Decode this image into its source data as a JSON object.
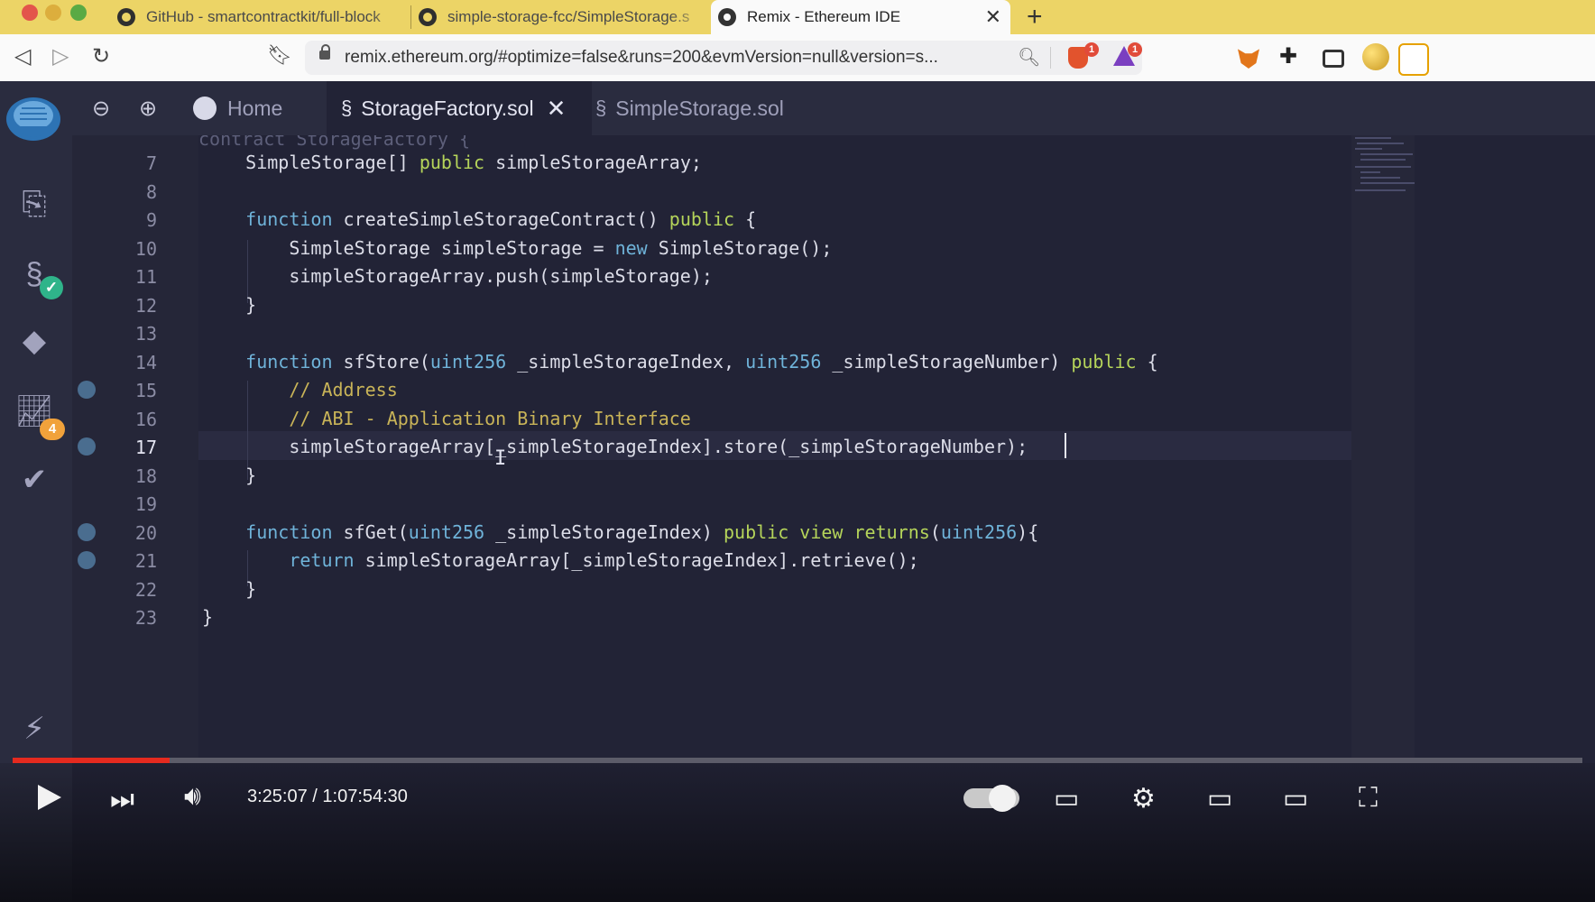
{
  "browser": {
    "tabs": [
      {
        "title": "GitHub - smartcontractkit/full-block",
        "icon": "github-icon"
      },
      {
        "title": "simple-storage-fcc/SimpleStorage.s",
        "icon": "github-icon"
      },
      {
        "title": "Remix - Ethereum IDE",
        "icon": "remix-icon",
        "active": true
      }
    ],
    "new_tab": "+",
    "close": "✕",
    "url": "remix.ethereum.org/#optimize=false&runs=200&evmVersion=null&version=s...",
    "brave_badge": "1",
    "rewards_badge": "1"
  },
  "remix": {
    "sidebar_badge": "4",
    "tabs": [
      {
        "label": "Home"
      },
      {
        "label": "StorageFactory.sol",
        "active": true
      },
      {
        "label": "SimpleStorage.sol"
      }
    ],
    "line_numbers": [
      "7",
      "8",
      "9",
      "10",
      "11",
      "12",
      "13",
      "14",
      "15",
      "16",
      "17",
      "18",
      "19",
      "20",
      "21",
      "22",
      "23"
    ],
    "current_line": "17",
    "breakpoint_lines": [
      "15",
      "17",
      "20",
      "21"
    ],
    "code_lines": [
      "    SimpleStorage[] public simpleStorageArray;",
      "",
      "    function createSimpleStorageContract() public {",
      "        SimpleStorage simpleStorage = new SimpleStorage();",
      "        simpleStorageArray.push(simpleStorage);",
      "    }",
      "",
      "    function sfStore(uint256 _simpleStorageIndex, uint256 _simpleStorageNumber) public {",
      "        // Address",
      "        // ABI - Application Binary Interface",
      "        simpleStorageArray[_simpleStorageIndex].store(_simpleStorageNumber);",
      "    }",
      "",
      "    function sfGet(uint256 _simpleStorageIndex) public view returns(uint256){",
      "        return simpleStorageArray[_simpleStorageIndex].retrieve();",
      "    }",
      "}"
    ],
    "partial_top_line": "contract StorageFactory {"
  },
  "video": {
    "time": "3:25:07 / 1:07:54:30",
    "progress_fraction": 0.1
  },
  "colors": {
    "keyword": "#6fb3d9",
    "type": "#6fb3d9",
    "modifier": "#b5d45a",
    "comment": "#c9b458",
    "text": "#dcdde8",
    "progress": "#e52a1f"
  }
}
